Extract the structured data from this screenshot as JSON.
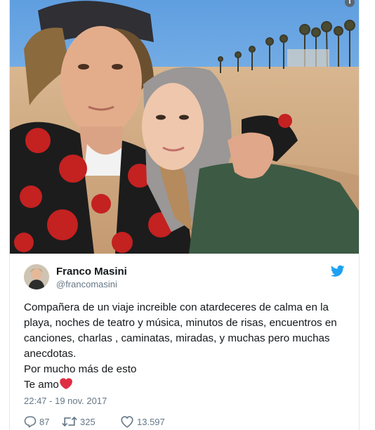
{
  "tweet": {
    "author_name": "Franco Masini",
    "author_handle": "@francomasini",
    "lines": [
      "Compañera de un viaje increible con atardeceres de calma en la playa, noches de teatro y música, minutos de risas, encuentros en canciones, charlas , caminatas, miradas, y muchas pero muchas anecdotas.",
      "Por mucho más de esto",
      "Te amo"
    ],
    "timestamp": "22:47 - 19 nov. 2017"
  },
  "actions": {
    "replies": "87",
    "retweets": "325",
    "likes": "13.597"
  },
  "icons": {
    "info": "info-icon",
    "bird": "twitter-bird-icon",
    "reply": "reply-icon",
    "retweet": "retweet-icon",
    "like": "heart-icon",
    "emoji": "red-heart-emoji"
  },
  "colors": {
    "twitter_blue": "#1da1f2",
    "text": "#14171a",
    "secondary": "#657786",
    "heart_emoji": "#dd2e44"
  }
}
